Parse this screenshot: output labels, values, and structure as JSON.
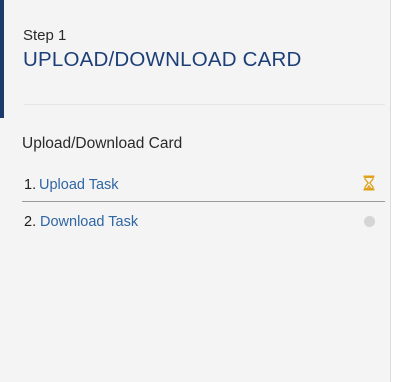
{
  "step": {
    "label": "Step 1",
    "title": "UPLOAD/DOWNLOAD CARD"
  },
  "card": {
    "title": "Upload/Download Card",
    "tasks": [
      {
        "number": "1.",
        "label": "Upload Task",
        "status_icon": "hourglass-icon",
        "status": "in-progress"
      },
      {
        "number": "2.",
        "label": "Download Task",
        "status_icon": "pending-dot-icon",
        "status": "pending"
      }
    ]
  },
  "colors": {
    "accent": "#1c3f78",
    "link": "#2f66a3",
    "in_progress": "#e0a21a",
    "pending": "#d5d5d5"
  }
}
